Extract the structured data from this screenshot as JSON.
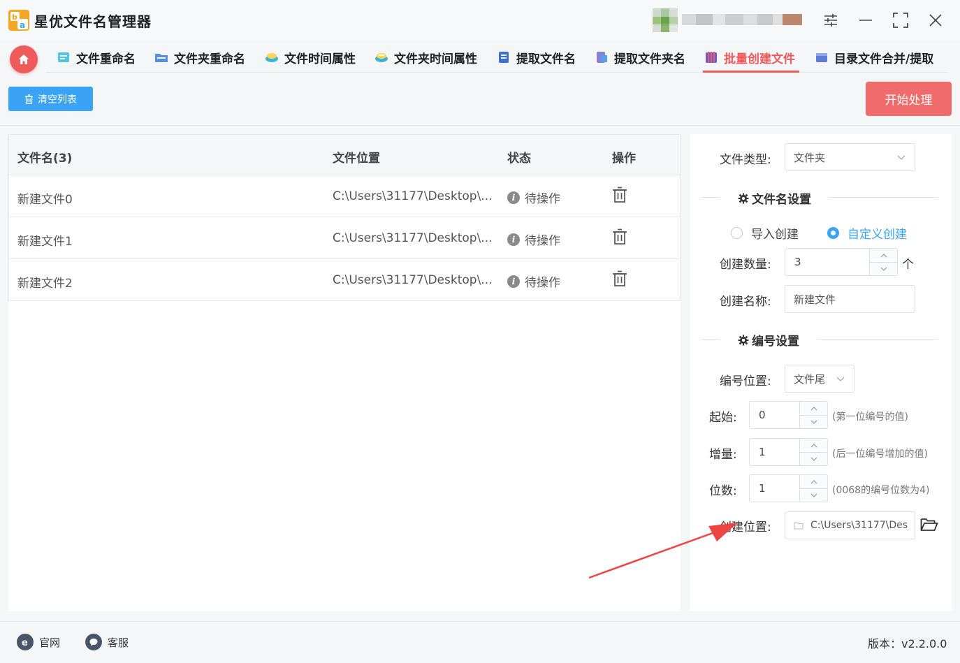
{
  "app": {
    "title": "星优文件名管理器"
  },
  "nav": {
    "tabs": [
      {
        "label": "文件重命名",
        "icon": "rename-file-icon",
        "active": false
      },
      {
        "label": "文件夹重命名",
        "icon": "rename-folder-icon",
        "active": false
      },
      {
        "label": "文件时间属性",
        "icon": "file-time-icon",
        "active": false
      },
      {
        "label": "文件夹时间属性",
        "icon": "folder-time-icon",
        "active": false
      },
      {
        "label": "提取文件名",
        "icon": "extract-filename-icon",
        "active": false
      },
      {
        "label": "提取文件夹名",
        "icon": "extract-foldername-icon",
        "active": false
      },
      {
        "label": "批量创建文件",
        "icon": "batch-create-icon",
        "active": true
      },
      {
        "label": "目录文件合并/提取",
        "icon": "dir-merge-icon",
        "active": false
      }
    ]
  },
  "toolbar": {
    "clear_label": "清空列表",
    "start_label": "开始处理"
  },
  "table": {
    "headers": {
      "name": "文件名(3)",
      "location": "文件位置",
      "status": "状态",
      "action": "操作"
    },
    "rows": [
      {
        "name": "新建文件0",
        "location": "C:\\Users\\31177\\Desktop\\...",
        "status": "待操作"
      },
      {
        "name": "新建文件1",
        "location": "C:\\Users\\31177\\Desktop\\...",
        "status": "待操作"
      },
      {
        "name": "新建文件2",
        "location": "C:\\Users\\31177\\Desktop\\...",
        "status": "待操作"
      }
    ]
  },
  "settings": {
    "file_type_label": "文件类型:",
    "file_type_value": "文件夹",
    "filename_section": "文件名设置",
    "radio_import": "导入创建",
    "radio_custom": "自定义创建",
    "radio_selected": "custom",
    "count_label": "创建数量:",
    "count_value": "3",
    "count_unit": "个",
    "name_label": "创建名称:",
    "name_value": "新建文件",
    "numbering_section": "编号设置",
    "position_label": "编号位置:",
    "position_value": "文件尾",
    "start_label": "起始:",
    "start_value": "0",
    "start_hint": "(第一位编号的值)",
    "increment_label": "增量:",
    "increment_value": "1",
    "increment_hint": "(后一位编号增加的值)",
    "digits_label": "位数:",
    "digits_value": "1",
    "digits_hint": "(0068的编号位数为4)",
    "location_label": "创建位置:",
    "location_value": "C:\\Users\\31177\\Des"
  },
  "footer": {
    "website": "官网",
    "support": "客服",
    "version": "版本：v2.2.0.0"
  },
  "colors": {
    "accent": "#ef5b5b",
    "primary": "#3ba3f5",
    "annotation_arrow": "#ef4444"
  }
}
